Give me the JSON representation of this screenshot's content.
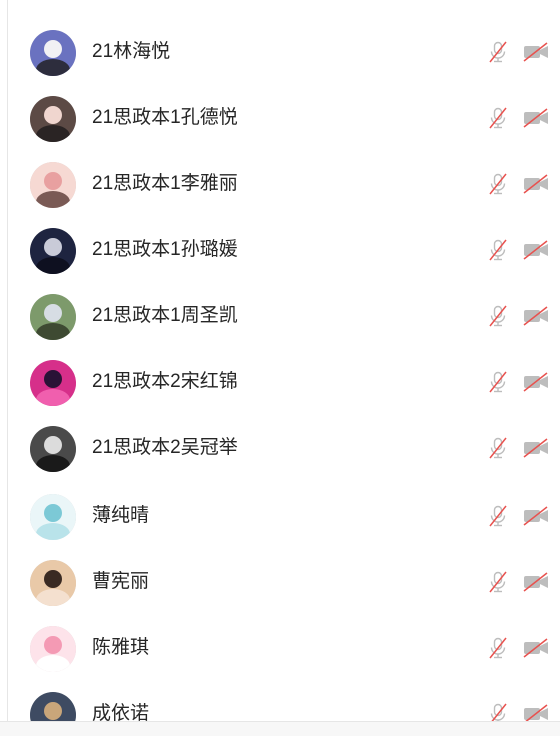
{
  "members": [
    {
      "name": "21林海悦",
      "avatar_colors": [
        "#6a72c0",
        "#f1f1f4",
        "#2d2d3d"
      ]
    },
    {
      "name": "21思政本1孔德悦",
      "avatar_colors": [
        "#5c4a45",
        "#f0d6cf",
        "#2a2424"
      ]
    },
    {
      "name": "21思政本1李雅丽",
      "avatar_colors": [
        "#f6d9d3",
        "#e8a0a0",
        "#7a5a55"
      ]
    },
    {
      "name": "21思政本1孙璐媛",
      "avatar_colors": [
        "#1e2440",
        "#c9cbd8",
        "#0e1020"
      ]
    },
    {
      "name": "21思政本1周圣凯",
      "avatar_colors": [
        "#7d9a6b",
        "#d7dde4",
        "#3e4a32"
      ]
    },
    {
      "name": "21思政本2宋红锦",
      "avatar_colors": [
        "#d62f8a",
        "#2a1236",
        "#f05fae"
      ]
    },
    {
      "name": "21思政本2吴冠举",
      "avatar_colors": [
        "#4a4a4a",
        "#dcdcdc",
        "#1a1a1a"
      ]
    },
    {
      "name": "薄纯晴",
      "avatar_colors": [
        "#eaf6f8",
        "#7cc9d6",
        "#b9e3ea"
      ]
    },
    {
      "name": "曹宪丽",
      "avatar_colors": [
        "#e9c9a8",
        "#3a2a22",
        "#f4e0cf"
      ]
    },
    {
      "name": "陈雅琪",
      "avatar_colors": [
        "#fde3ea",
        "#f49ab4",
        "#ffffff"
      ]
    },
    {
      "name": "成依诺",
      "avatar_colors": [
        "#3e4b62",
        "#c9a67a",
        "#6a7a94"
      ]
    }
  ],
  "icons": {
    "mic": "mic-muted-icon",
    "cam": "camera-off-icon",
    "slash_color": "#e8524f",
    "glyph_color": "#bdbdbd"
  }
}
